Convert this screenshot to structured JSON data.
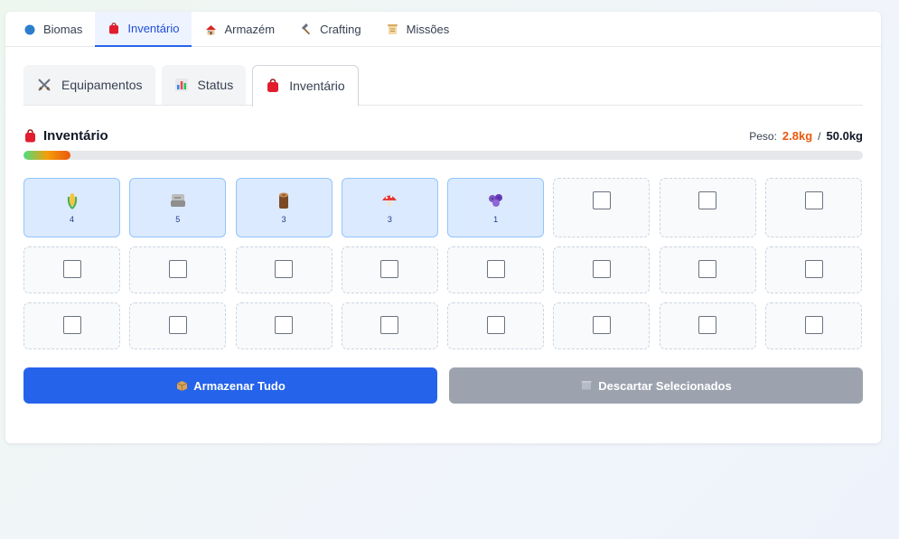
{
  "top_tabs": [
    {
      "label": "Biomas",
      "icon": "globe-icon",
      "active": false
    },
    {
      "label": "Inventário",
      "icon": "bag-icon",
      "active": true
    },
    {
      "label": "Armazém",
      "icon": "house-icon",
      "active": false
    },
    {
      "label": "Crafting",
      "icon": "hammer-icon",
      "active": false
    },
    {
      "label": "Missões",
      "icon": "scroll-icon",
      "active": false
    }
  ],
  "sub_tabs": [
    {
      "label": "Equipamentos",
      "icon": "crossed-swords-icon",
      "active": false
    },
    {
      "label": "Status",
      "icon": "bar-chart-icon",
      "active": false
    },
    {
      "label": "Inventário",
      "icon": "bag-icon",
      "active": true
    }
  ],
  "inventory": {
    "title": "Inventário",
    "weight_label": "Peso:",
    "weight_current": "2.8kg",
    "weight_sep": "/",
    "weight_max": "50.0kg",
    "weight_fraction": 0.056
  },
  "items": [
    {
      "icon": "corn-icon",
      "qty": "4"
    },
    {
      "icon": "stone-icon",
      "qty": "5"
    },
    {
      "icon": "wood-log-icon",
      "qty": "3"
    },
    {
      "icon": "mushroom-icon",
      "qty": "3"
    },
    {
      "icon": "berries-icon",
      "qty": "1"
    }
  ],
  "total_slots": 24,
  "buttons": {
    "store_all": "Armazenar Tudo",
    "discard_selected": "Descartar Selecionados"
  },
  "colors": {
    "accent": "#2563eb",
    "weight_current": "#ea580c",
    "disabled": "#9ca3af",
    "slot_filled": "#dbeafe"
  }
}
